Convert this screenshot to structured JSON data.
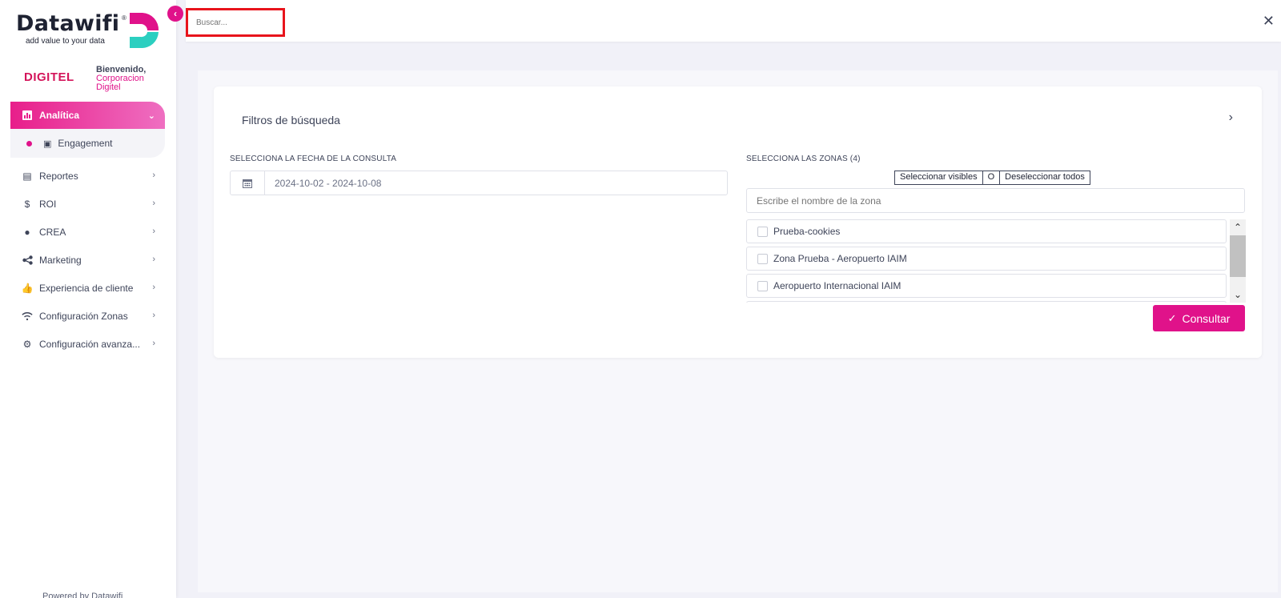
{
  "app": {
    "logo_word": "Datawifi",
    "logo_reg": "®",
    "logo_tagline": "add value to your data",
    "brand": "DIGITEL",
    "welcome_line1": "Bienvenido,",
    "welcome_line2": "Corporacion",
    "welcome_line3": "Digitel",
    "powered_by": "Powered by Datawifi",
    "accent_color": "#e0128a"
  },
  "sidebar": {
    "items": [
      {
        "label": "Analítica",
        "icon": "bar-chart-icon"
      },
      {
        "label": "Engagement",
        "icon": "contact-card-icon"
      },
      {
        "label": "Reportes",
        "icon": "document-icon"
      },
      {
        "label": "ROI",
        "icon": "money-icon"
      },
      {
        "label": "CREA",
        "icon": "lightbulb-icon"
      },
      {
        "label": "Marketing",
        "icon": "share-icon"
      },
      {
        "label": "Experiencia de cliente",
        "icon": "thumbs-up-icon"
      },
      {
        "label": "Configuración Zonas",
        "icon": "wifi-icon"
      },
      {
        "label": "Configuración avanza...",
        "icon": "gear-icon"
      }
    ]
  },
  "topbar": {
    "search_placeholder": "Buscar...",
    "close_symbol": "✕"
  },
  "filters": {
    "title": "Filtros de búsqueda",
    "date_label": "SELECCIONA LA FECHA DE LA CONSULTA",
    "date_range": "2024-10-02 - 2024-10-08",
    "zones_label": "SELECCIONA LAS ZONAS (4)",
    "select_visible": "Seleccionar visibles",
    "or": "O",
    "deselect_all": "Deseleccionar todos",
    "zone_search_placeholder": "Escribe el nombre de la zona",
    "zones": [
      "Prueba-cookies",
      "Zona Prueba - Aeropuerto IAIM",
      "Aeropuerto Internacional IAIM"
    ],
    "submit_label": "Consultar"
  }
}
